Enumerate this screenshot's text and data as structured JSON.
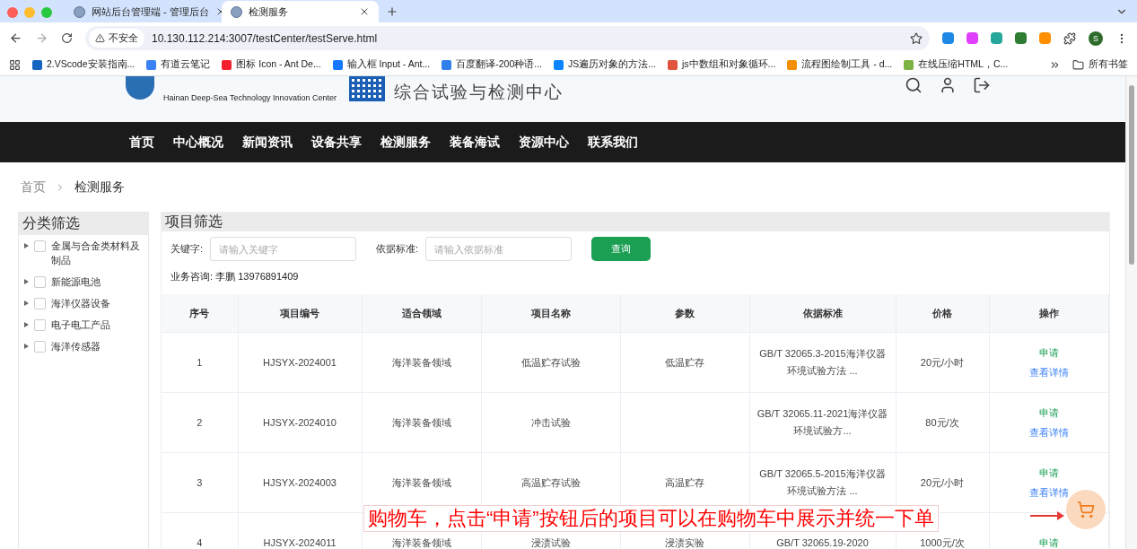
{
  "browser": {
    "tabs": [
      {
        "title": "网站后台管理端 - 管理后台",
        "selected": false
      },
      {
        "title": "检测服务",
        "selected": true
      }
    ],
    "address": {
      "security_label": "不安全",
      "url": "10.130.112.214:3007/testCenter/testServe.html"
    },
    "extensions": [
      {
        "color": "#1e88e5"
      },
      {
        "color": "#e040fb"
      },
      {
        "color": "#26a69a"
      },
      {
        "color": "#2e7d32"
      },
      {
        "color": "#ff8f00"
      }
    ],
    "profile_initial": "S",
    "bookmarks": [
      {
        "label": "2.VScode安装指南...",
        "color": "#1565c0"
      },
      {
        "label": "有道云笔记",
        "color": "#3b82f6"
      },
      {
        "label": "图标 Icon - Ant De...",
        "color": "#f5222d"
      },
      {
        "label": "输入框 Input - Ant...",
        "color": "#1677ff"
      },
      {
        "label": "百度翻译-200种语...",
        "color": "#2f80ed"
      },
      {
        "label": "JS遍历对象的方法...",
        "color": "#0a84ff"
      },
      {
        "label": "js中数组和对象循环...",
        "color": "#e0533c"
      },
      {
        "label": "流程图绘制工具 - d...",
        "color": "#f29000"
      },
      {
        "label": "在线压缩HTML，C...",
        "color": "#7cb342"
      }
    ],
    "all_bookmarks": "所有书签"
  },
  "site": {
    "header": {
      "subtitle_en": "Hainan Deep-Sea Technology Innovation Center",
      "center_name": "综合试验与检测中心"
    },
    "nav": [
      {
        "label": "首页"
      },
      {
        "label": "中心概况"
      },
      {
        "label": "新闻资讯"
      },
      {
        "label": "设备共享"
      },
      {
        "label": "检测服务"
      },
      {
        "label": "装备海试"
      },
      {
        "label": "资源中心"
      },
      {
        "label": "联系我们"
      }
    ],
    "breadcrumb": [
      "首页",
      "检测服务"
    ],
    "sidebar": {
      "title": "分类筛选",
      "categories": [
        {
          "label": "金属与合金类材料及制品",
          "checked": false,
          "expanded": false
        },
        {
          "label": "新能源电池",
          "checked": false,
          "expanded": false
        },
        {
          "label": "海洋仪器设备",
          "checked": false,
          "expanded": false
        },
        {
          "label": "电子电工产品",
          "checked": false,
          "expanded": false
        },
        {
          "label": "海洋传感器",
          "checked": false,
          "expanded": false
        }
      ]
    },
    "filter": {
      "title": "项目筛选",
      "fields": [
        {
          "label": "关键字:",
          "placeholder": "请输入关键字"
        },
        {
          "label": "依据标准:",
          "placeholder": "请输入依据标准"
        }
      ],
      "button": "查询",
      "consult": "业务咨询: 李鹏 13976891409"
    },
    "table": {
      "columns": [
        "序号",
        "项目编号",
        "适合领域",
        "项目名称",
        "参数",
        "依据标准",
        "价格",
        "操作"
      ],
      "rows": [
        {
          "cells": [
            "1",
            "HJSYX-2024001",
            "海洋装备领域",
            "低温贮存试验",
            "低温贮存",
            "GB/T 32065.3-2015海洋仪器环境试验方法 ...",
            "20元/小时"
          ],
          "actions": [
            {
              "label": "申请",
              "kind": "apply"
            },
            {
              "label": "查看详情",
              "kind": "detail"
            }
          ]
        },
        {
          "cells": [
            "2",
            "HJSYX-2024010",
            "海洋装备领域",
            "冲击试验",
            "",
            "GB/T 32065.11-2021海洋仪器环境试验方...",
            "80元/次"
          ],
          "actions": [
            {
              "label": "申请",
              "kind": "apply"
            },
            {
              "label": "查看详情",
              "kind": "detail"
            }
          ]
        },
        {
          "cells": [
            "3",
            "HJSYX-2024003",
            "海洋装备领域",
            "高温贮存试验",
            "高温贮存",
            "GB/T 32065.5-2015海洋仪器环境试验方法 ...",
            "20元/小时"
          ],
          "actions": [
            {
              "label": "申请",
              "kind": "apply"
            },
            {
              "label": "查看详情",
              "kind": "detail"
            }
          ]
        },
        {
          "cells": [
            "4",
            "HJSYX-2024011",
            "海洋装备领域",
            "浸渍试验",
            "浸渍实验",
            "GB/T 32065.19-2020",
            "1000元/次"
          ],
          "actions": [
            {
              "label": "申请",
              "kind": "apply"
            }
          ]
        }
      ]
    },
    "annotation": {
      "text": "购物车，点击“申请”按钮后的项目可以在购物车中展示并统一下单"
    }
  }
}
